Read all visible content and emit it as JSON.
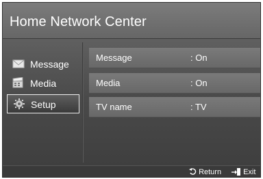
{
  "window": {
    "title": "Home Network Center"
  },
  "sidebar": {
    "items": [
      {
        "label": "Message",
        "icon": "envelope-icon",
        "selected": false
      },
      {
        "label": "Media",
        "icon": "media-clapper-icon",
        "selected": false
      },
      {
        "label": "Setup",
        "icon": "gear-icon",
        "selected": true
      }
    ]
  },
  "settings": {
    "rows": [
      {
        "name": "Message",
        "value": ": On"
      },
      {
        "name": "Media",
        "value": ": On"
      },
      {
        "name": "TV name",
        "value": ": TV"
      }
    ]
  },
  "footer": {
    "return_label": "Return",
    "exit_label": "Exit",
    "return_icon": "return-arrow-icon",
    "exit_icon": "exit-door-icon"
  }
}
